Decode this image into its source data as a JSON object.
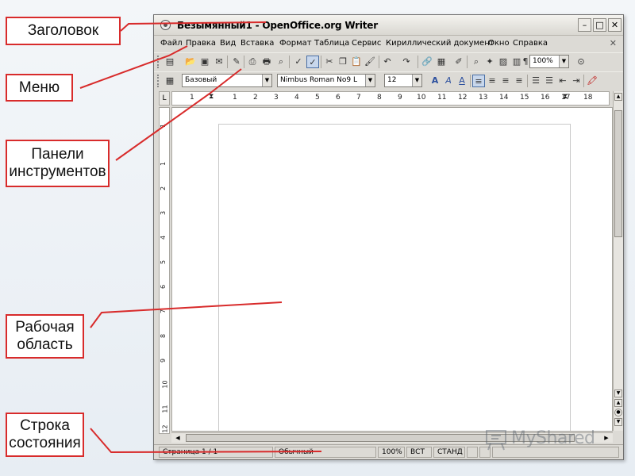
{
  "callouts": {
    "title": "Заголовок",
    "menu": "Меню",
    "toolbars_1": "Панели",
    "toolbars_2": "инструментов",
    "workarea_1": "Рабочая",
    "workarea_2": "область",
    "status_1": "Строка",
    "status_2": "состояния"
  },
  "colors": {
    "callout_border": "#d82b2b",
    "leader_line": "#d82b2b",
    "window_bg": "#dcdad5",
    "selection": "#c8d7ec"
  },
  "window": {
    "title": "Безымянный1 - OpenOffice.org Writer",
    "buttons": [
      "–",
      "□",
      "✕"
    ],
    "doc_close": "✕"
  },
  "menu": [
    {
      "label": "Файл"
    },
    {
      "label": "Правка"
    },
    {
      "label": "Вид"
    },
    {
      "label": "Вставка"
    },
    {
      "label": "Формат"
    },
    {
      "label": "Таблица"
    },
    {
      "label": "Сервис"
    },
    {
      "label": "Кириллический документ"
    },
    {
      "label": "Окно"
    },
    {
      "label": "Справка"
    }
  ],
  "toolbar1": {
    "zoom": "100%"
  },
  "toolbar2": {
    "style": "Базовый",
    "font": "Nimbus Roman No9 L",
    "size": "12"
  },
  "ruler": {
    "h_ticks": [
      "1",
      "1",
      "2",
      "3",
      "4",
      "5",
      "6",
      "7",
      "8",
      "9",
      "10",
      "11",
      "12",
      "13",
      "14",
      "15",
      "16",
      "17",
      "18"
    ],
    "v_ticks": [
      "1",
      "1",
      "2",
      "3",
      "4",
      "5",
      "6",
      "7",
      "8",
      "9",
      "10",
      "11",
      "12"
    ]
  },
  "status": {
    "page": "Страница 1 / 1",
    "style": "Обычный",
    "zoom": "100%",
    "insert": "ВСТ",
    "mode": "СТАНД"
  },
  "watermark": "MyShared"
}
